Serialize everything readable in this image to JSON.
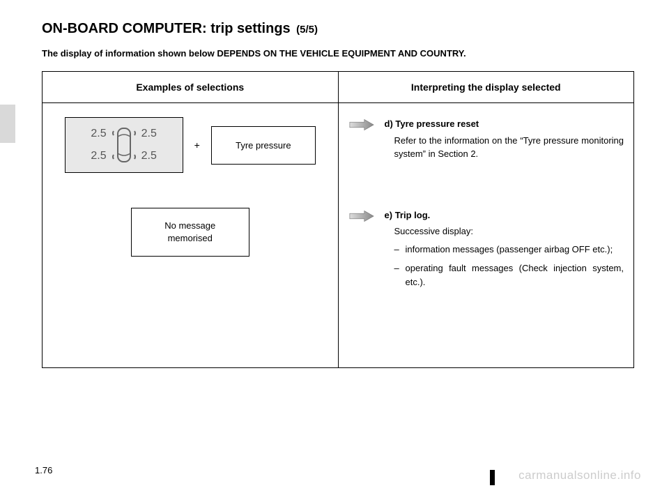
{
  "title": {
    "main": "ON-BOARD COMPUTER: trip settings",
    "part": "(5/5)"
  },
  "note": "The display of information shown below DEPENDS ON THE VEHICLE EQUIPMENT AND COUNTRY.",
  "table": {
    "header_left": "Examples of selections",
    "header_right": "Interpreting the display selected",
    "left": {
      "tyre_values": {
        "front_left": "2.5",
        "rear_left": "2.5",
        "front_right": "2.5",
        "rear_right": "2.5"
      },
      "plus": "+",
      "tyre_label": "Tyre pressure",
      "message_box_line1": "No message",
      "message_box_line2": "memorised"
    },
    "right": {
      "d": {
        "prefix": "d)",
        "heading": "Tyre pressure reset",
        "body": "Refer to the information on the “Tyre pressure monitoring system” in Section 2."
      },
      "e": {
        "prefix": "e)",
        "heading": "Trip log.",
        "sub": "Successive display:",
        "bullets": [
          "information messages (passenger airbag OFF etc.);",
          "operating fault messages (Check injection system, etc.)."
        ]
      }
    }
  },
  "page_number": "1.76",
  "watermark": "carmanualsonline.info"
}
